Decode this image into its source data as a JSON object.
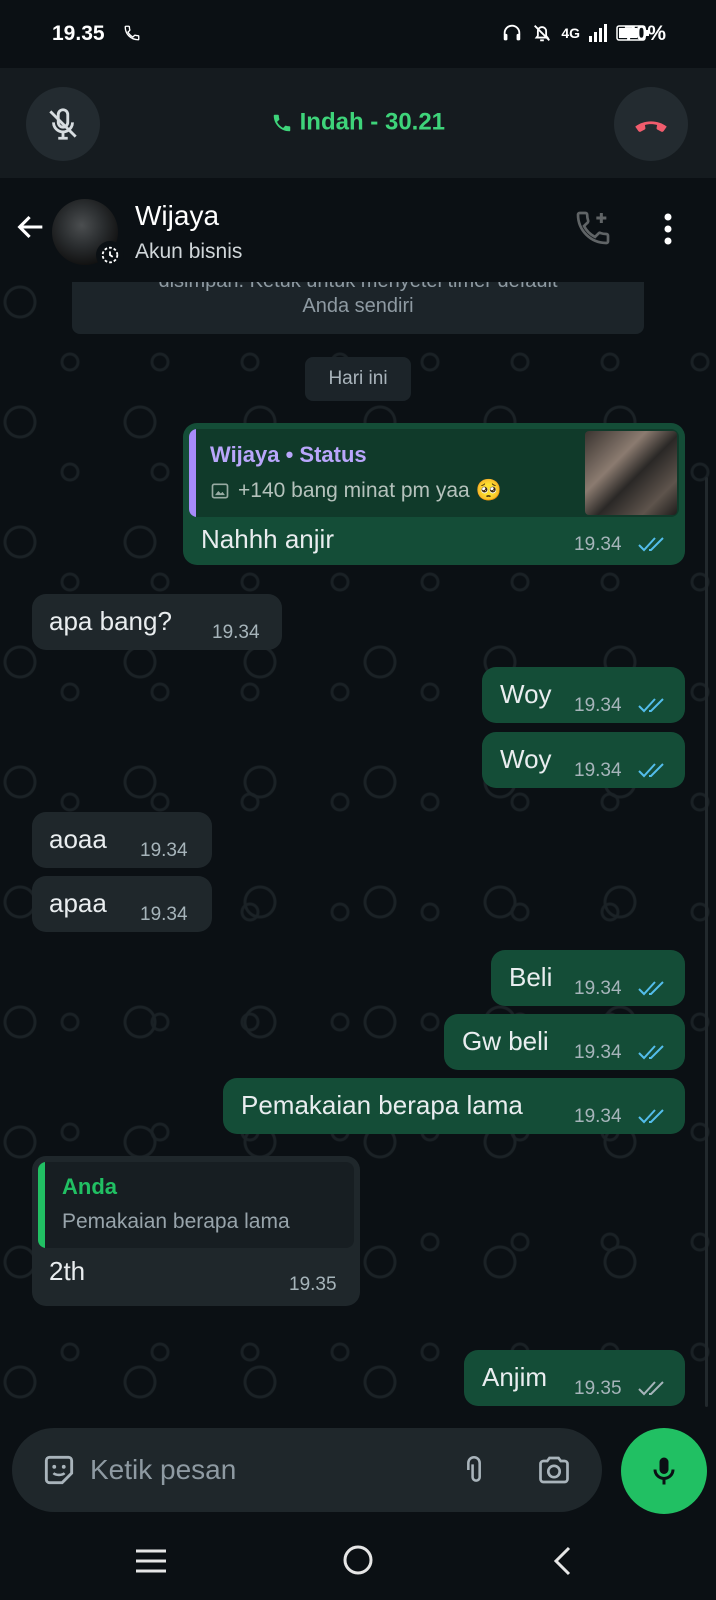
{
  "status_bar": {
    "time": "19.35",
    "network": "4G",
    "battery": "70%"
  },
  "call": {
    "title": "Indah - 30.21",
    "accent": "#3ed47a",
    "end_color": "#f15c6d"
  },
  "header": {
    "name": "Wijaya",
    "subtitle": "Akun bisnis"
  },
  "system_message": {
    "line1": "disimpan. Ketuk untuk menyetel timer default",
    "line2": "Anda sendiri"
  },
  "day_divider": "Hari ini",
  "messages": [
    {
      "direction": "out",
      "quote_title": "Wijaya • Status",
      "quote_text": "+140 bang minat pm yaa 🥺",
      "text": "Nahhh anjir",
      "time": "19.34",
      "status": "read"
    },
    {
      "direction": "in",
      "text": "apa bang?",
      "time": "19.34"
    },
    {
      "direction": "out",
      "text": "Woy",
      "time": "19.34",
      "status": "read"
    },
    {
      "direction": "out",
      "text": "Woy",
      "time": "19.34",
      "status": "read"
    },
    {
      "direction": "in",
      "text": "aoaa",
      "time": "19.34"
    },
    {
      "direction": "in",
      "text": "apaa",
      "time": "19.34"
    },
    {
      "direction": "out",
      "text": "Beli",
      "time": "19.34",
      "status": "read"
    },
    {
      "direction": "out",
      "text": "Gw beli",
      "time": "19.34",
      "status": "read"
    },
    {
      "direction": "out",
      "text": "Pemakaian berapa lama",
      "time": "19.34",
      "status": "read"
    },
    {
      "direction": "in",
      "quote_title": "Anda",
      "quote_text": "Pemakaian berapa lama",
      "text": "2th",
      "time": "19.35"
    },
    {
      "direction": "out",
      "text": "Anjim",
      "time": "19.35",
      "status": "delivered"
    }
  ],
  "composer": {
    "placeholder": "Ketik pesan"
  },
  "colors": {
    "outgoing_bubble": "#144d37",
    "incoming_bubble": "#1f272b",
    "read_ticks": "#53bdeb",
    "status_quote_bar": "#a78bfa",
    "reply_quote_bar": "#21c063"
  },
  "icons": [
    "phone-icon",
    "headphones-icon",
    "bell-off-icon",
    "signal-icon",
    "battery-icon",
    "mic-off-icon",
    "end-call-icon",
    "back-arrow-icon",
    "timer-icon",
    "add-call-icon",
    "more-vert-icon",
    "image-icon",
    "double-check-icon",
    "emoji-icon",
    "attach-icon",
    "camera-icon",
    "mic-icon",
    "menu-icon",
    "home-icon",
    "chevron-left-icon"
  ]
}
